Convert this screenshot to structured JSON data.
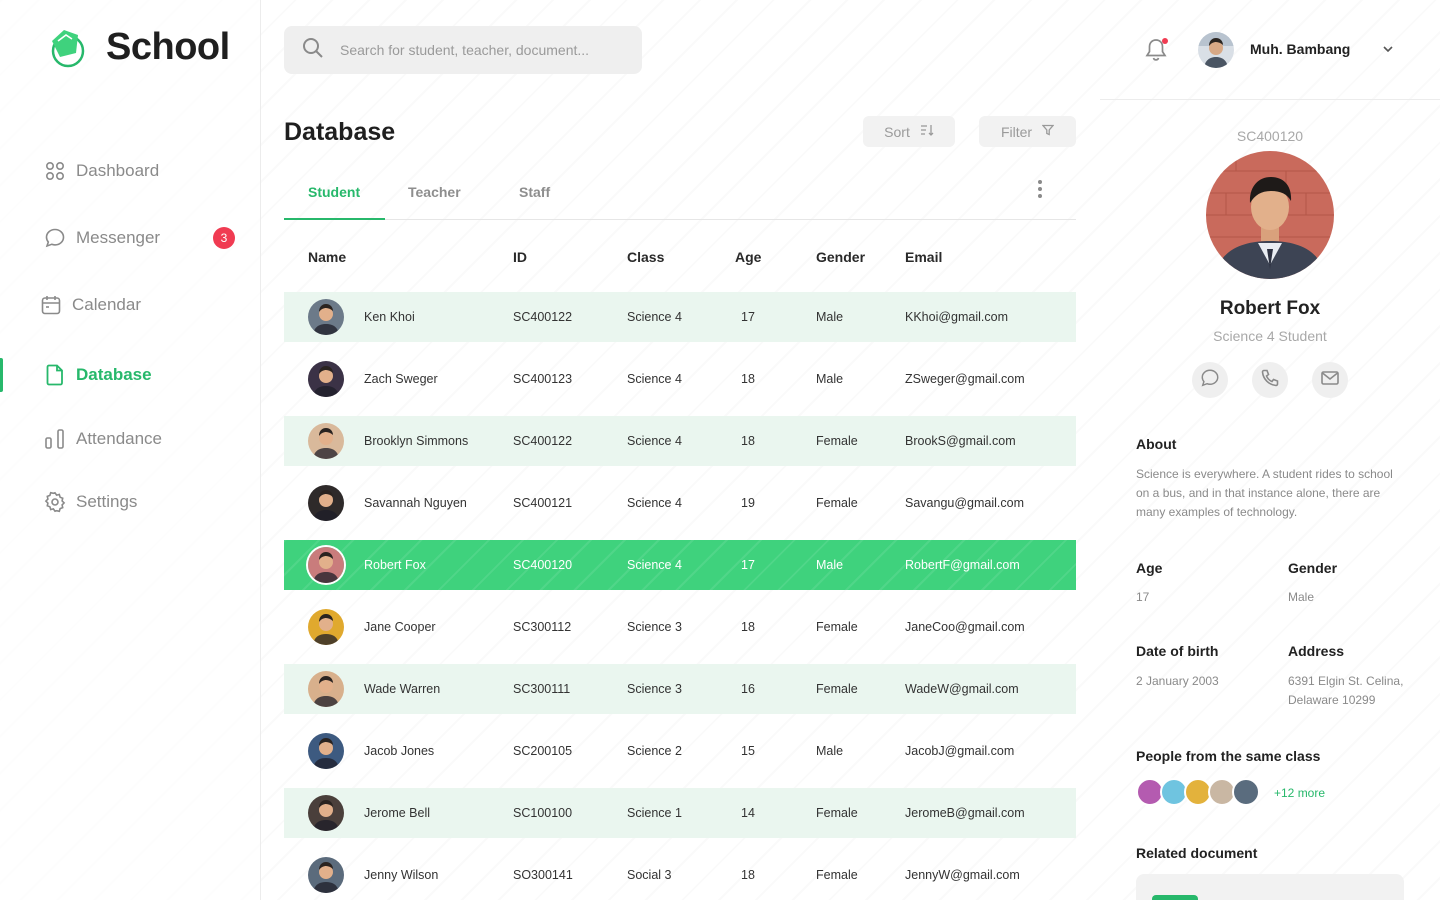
{
  "app": {
    "name": "School",
    "accent": "#27b86b"
  },
  "sidebar": {
    "items": [
      {
        "label": "Dashboard",
        "icon": "grid-icon"
      },
      {
        "label": "Messenger",
        "icon": "chat-icon",
        "badge": "3"
      },
      {
        "label": "Calendar",
        "icon": "calendar-icon"
      },
      {
        "label": "Database",
        "icon": "document-icon",
        "active": true
      },
      {
        "label": "Attendance",
        "icon": "bar-chart-icon"
      },
      {
        "label": "Settings",
        "icon": "gear-icon"
      }
    ]
  },
  "search": {
    "placeholder": "Search for student, teacher, document..."
  },
  "header": {
    "title": "Database",
    "sort_label": "Sort",
    "filter_label": "Filter"
  },
  "tabs": [
    "Student",
    "Teacher",
    "Staff"
  ],
  "table": {
    "columns": [
      "Name",
      "ID",
      "Class",
      "Age",
      "Gender",
      "Email"
    ],
    "rows": [
      {
        "name": "Ken Khoi",
        "id": "SC400122",
        "class": "Science 4",
        "age": "17",
        "gender": "Male",
        "email": "KKhoi@gmail.com"
      },
      {
        "name": "Zach Sweger",
        "id": "SC400123",
        "class": "Science 4",
        "age": "18",
        "gender": "Male",
        "email": "ZSweger@gmail.com"
      },
      {
        "name": "Brooklyn Simmons",
        "id": "SC400122",
        "class": "Science 4",
        "age": "18",
        "gender": "Female",
        "email": "BrookS@gmail.com"
      },
      {
        "name": "Savannah Nguyen",
        "id": "SC400121",
        "class": "Science 4",
        "age": "19",
        "gender": "Female",
        "email": "Savangu@gmail.com"
      },
      {
        "name": "Robert Fox",
        "id": "SC400120",
        "class": "Science 4",
        "age": "17",
        "gender": "Male",
        "email": "RobertF@gmail.com"
      },
      {
        "name": "Jane Cooper",
        "id": "SC300112",
        "class": "Science 3",
        "age": "18",
        "gender": "Female",
        "email": "JaneCoo@gmail.com"
      },
      {
        "name": "Wade Warren",
        "id": "SC300111",
        "class": "Science 3",
        "age": "16",
        "gender": "Female",
        "email": "WadeW@gmail.com"
      },
      {
        "name": "Jacob Jones",
        "id": "SC200105",
        "class": "Science 2",
        "age": "15",
        "gender": "Male",
        "email": "JacobJ@gmail.com"
      },
      {
        "name": "Jerome Bell",
        "id": "SC100100",
        "class": "Science 1",
        "age": "14",
        "gender": "Female",
        "email": "JeromeB@gmail.com"
      },
      {
        "name": "Jenny Wilson",
        "id": "SO300141",
        "class": "Social 3",
        "age": "18",
        "gender": "Female",
        "email": "JennyW@gmail.com"
      }
    ]
  },
  "user": {
    "name": "Muh. Bambang"
  },
  "profile": {
    "id": "SC400120",
    "name": "Robert Fox",
    "role": "Science 4 Student",
    "about_label": "About",
    "about_text": "Science is everywhere. A student rides to school on a bus, and in that instance alone, there are many examples of technology.",
    "age_label": "Age",
    "age": "17",
    "gender_label": "Gender",
    "gender": "Male",
    "dob_label": "Date of birth",
    "dob": "2 January 2003",
    "address_label": "Address",
    "address": "6391 Elgin St. Celina, Delaware 10299",
    "classmates_label": "People from the same class",
    "classmates_more": "+12 more",
    "related_label": "Related document"
  }
}
